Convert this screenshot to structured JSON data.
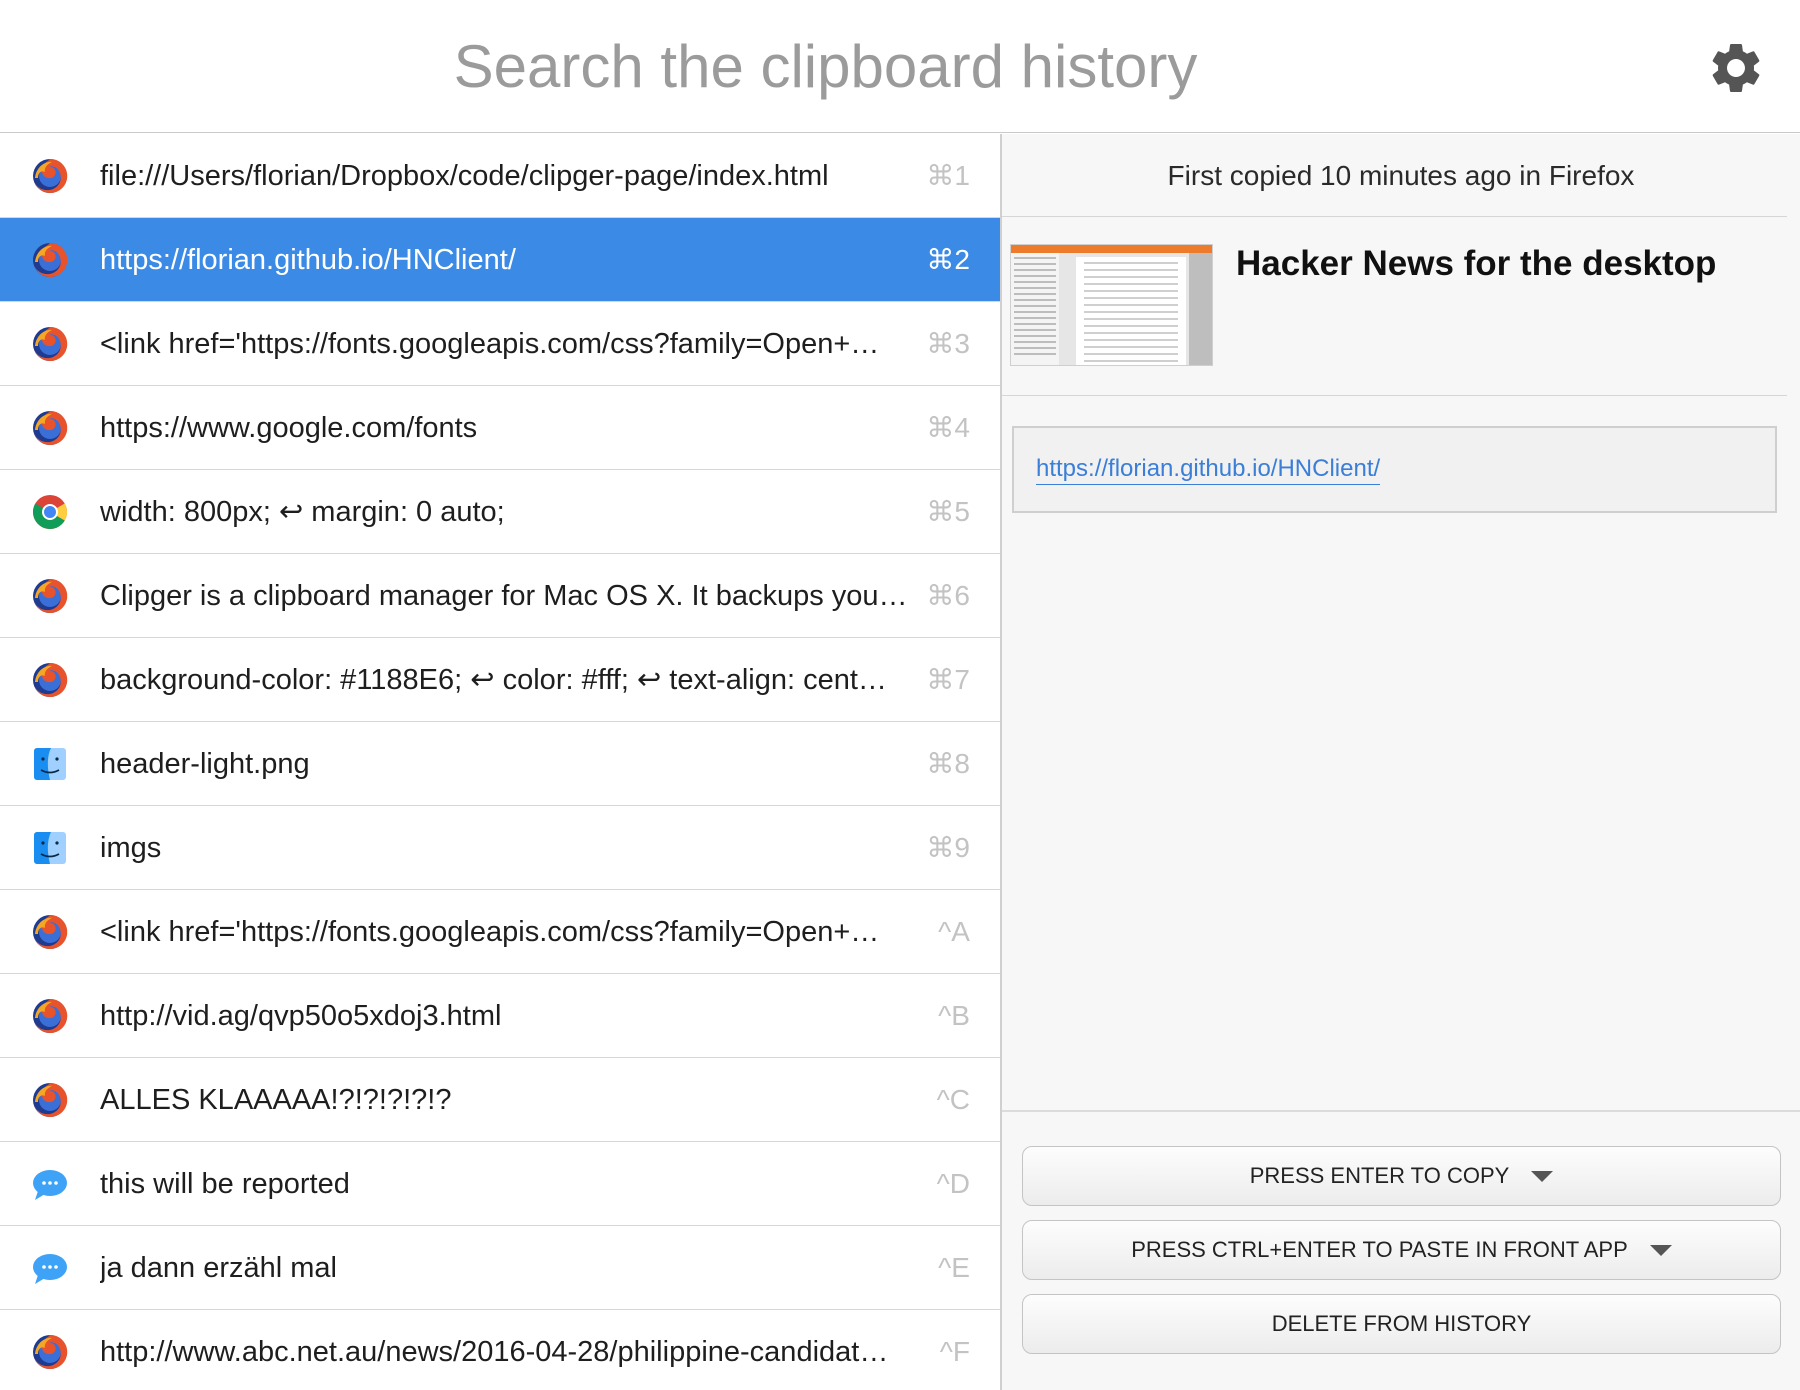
{
  "search": {
    "placeholder": "Search the clipboard history",
    "settings_icon": "gear-icon"
  },
  "items": [
    {
      "app": "firefox",
      "text": "file:///Users/florian/Dropbox/code/clipger-page/index.html",
      "shortcut": "⌘1"
    },
    {
      "app": "firefox",
      "text": "https://florian.github.io/HNClient/",
      "shortcut": "⌘2",
      "selected": true
    },
    {
      "app": "firefox",
      "text": "<link href='https://fonts.googleapis.com/css?family=Open+…",
      "shortcut": "⌘3"
    },
    {
      "app": "firefox",
      "text": "https://www.google.com/fonts",
      "shortcut": "⌘4"
    },
    {
      "app": "chrome",
      "text": "width: 800px; ↩ margin: 0 auto;",
      "shortcut": "⌘5"
    },
    {
      "app": "firefox",
      "text": "Clipger is a clipboard manager for Mac OS X. It backups your…",
      "shortcut": "⌘6"
    },
    {
      "app": "firefox",
      "text": "background-color: #1188E6; ↩ color: #fff; ↩ text-align: cent…",
      "shortcut": "⌘7"
    },
    {
      "app": "finder",
      "text": "header-light.png",
      "shortcut": "⌘8"
    },
    {
      "app": "finder",
      "text": "imgs",
      "shortcut": "⌘9"
    },
    {
      "app": "firefox",
      "text": "<link href='https://fonts.googleapis.com/css?family=Open+…",
      "shortcut": "^A"
    },
    {
      "app": "firefox",
      "text": "http://vid.ag/qvp50o5xdoj3.html",
      "shortcut": "^B"
    },
    {
      "app": "firefox",
      "text": "ALLES KLAAAAA!?!?!?!?!?",
      "shortcut": "^C"
    },
    {
      "app": "messages",
      "text": "this will be reported",
      "shortcut": "^D"
    },
    {
      "app": "messages",
      "text": "ja dann erzähl mal",
      "shortcut": "^E"
    },
    {
      "app": "firefox",
      "text": "http://www.abc.net.au/news/2016-04-28/philippine-candidat…",
      "shortcut": "^F"
    }
  ],
  "detail": {
    "copied_info": "First copied 10 minutes ago in Firefox",
    "link_title": "Hacker News for the desktop",
    "preview_url": "https://florian.github.io/HNClient/",
    "buttons": {
      "copy": "PRESS ENTER TO COPY",
      "paste": "PRESS CTRL+ENTER TO PASTE IN FRONT APP",
      "delete": "DELETE FROM HISTORY"
    }
  },
  "colors": {
    "selection": "#3b8be6",
    "link": "#3a7ed8",
    "shortcut": "#c3c3c3"
  }
}
